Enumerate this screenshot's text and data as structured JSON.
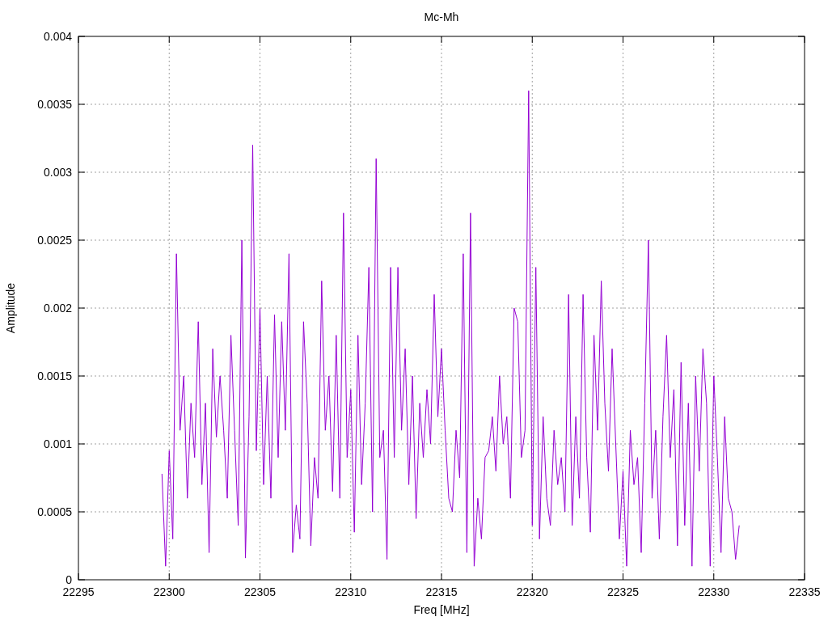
{
  "chart_data": {
    "type": "line",
    "title": "Mc-Mh",
    "xlabel": "Freq [MHz]",
    "ylabel": "Amplitude",
    "xlim": [
      22295,
      22335
    ],
    "ylim": [
      0,
      0.004
    ],
    "xticks": [
      22295,
      22300,
      22305,
      22310,
      22315,
      22320,
      22325,
      22330,
      22335
    ],
    "yticks": [
      0,
      0.0005,
      0.001,
      0.0015,
      0.002,
      0.0025,
      0.003,
      0.0035,
      0.004
    ],
    "x": [
      22299.6,
      22299.8,
      22300,
      22300.2,
      22300.4,
      22300.6,
      22300.8,
      22301,
      22301.2,
      22301.4,
      22301.6,
      22301.8,
      22302,
      22302.2,
      22302.4,
      22302.6,
      22302.8,
      22303,
      22303.2,
      22303.4,
      22303.6,
      22303.8,
      22304,
      22304.2,
      22304.4,
      22304.6,
      22304.8,
      22305,
      22305.2,
      22305.4,
      22305.6,
      22305.8,
      22306,
      22306.2,
      22306.4,
      22306.6,
      22306.8,
      22307,
      22307.2,
      22307.4,
      22307.6,
      22307.8,
      22308,
      22308.2,
      22308.4,
      22308.6,
      22308.8,
      22309,
      22309.2,
      22309.4,
      22309.6,
      22309.8,
      22310,
      22310.2,
      22310.4,
      22310.6,
      22310.8,
      22311,
      22311.2,
      22311.4,
      22311.6,
      22311.8,
      22312,
      22312.2,
      22312.4,
      22312.6,
      22312.8,
      22313,
      22313.2,
      22313.4,
      22313.6,
      22313.8,
      22314,
      22314.2,
      22314.4,
      22314.6,
      22314.8,
      22315,
      22315.2,
      22315.4,
      22315.6,
      22315.8,
      22316,
      22316.2,
      22316.4,
      22316.6,
      22316.8,
      22317,
      22317.2,
      22317.4,
      22317.6,
      22317.8,
      22318,
      22318.2,
      22318.4,
      22318.6,
      22318.8,
      22319,
      22319.2,
      22319.4,
      22319.6,
      22319.8,
      22320,
      22320.2,
      22320.4,
      22320.6,
      22320.8,
      22321,
      22321.2,
      22321.4,
      22321.6,
      22321.8,
      22322,
      22322.2,
      22322.4,
      22322.6,
      22322.8,
      22323,
      22323.2,
      22323.4,
      22323.6,
      22323.8,
      22324,
      22324.2,
      22324.4,
      22324.6,
      22324.8,
      22325,
      22325.2,
      22325.4,
      22325.6,
      22325.8,
      22326,
      22326.2,
      22326.4,
      22326.6,
      22326.8,
      22327,
      22327.2,
      22327.4,
      22327.6,
      22327.8,
      22328,
      22328.2,
      22328.4,
      22328.6,
      22328.8,
      22329,
      22329.2,
      22329.4,
      22329.6,
      22329.8,
      22330,
      22330.2,
      22330.4,
      22330.6,
      22330.8,
      22331,
      22331.2,
      22331.4
    ],
    "grid": true,
    "series": [
      {
        "color": "#9400d3",
        "values": [
          0.00078,
          0.0001,
          0.00095,
          0.0003,
          0.0024,
          0.0011,
          0.0015,
          0.0006,
          0.0013,
          0.0009,
          0.0019,
          0.0007,
          0.0013,
          0.0002,
          0.0017,
          0.00105,
          0.0015,
          0.0011,
          0.0006,
          0.0018,
          0.0011,
          0.0004,
          0.0025,
          0.00016,
          0.0012,
          0.0032,
          0.00095,
          0.002,
          0.0007,
          0.0015,
          0.0006,
          0.00195,
          0.0009,
          0.0019,
          0.0011,
          0.0024,
          0.0002,
          0.00055,
          0.0003,
          0.0019,
          0.0013,
          0.00025,
          0.0009,
          0.0006,
          0.0022,
          0.0011,
          0.0015,
          0.00065,
          0.0018,
          0.0006,
          0.0027,
          0.0009,
          0.0014,
          0.00035,
          0.0018,
          0.0007,
          0.0013,
          0.0023,
          0.0005,
          0.0031,
          0.0009,
          0.0011,
          0.00015,
          0.0023,
          0.0009,
          0.0023,
          0.0011,
          0.0017,
          0.0007,
          0.0015,
          0.00045,
          0.0013,
          0.0009,
          0.0014,
          0.001,
          0.0021,
          0.0012,
          0.0017,
          0.0011,
          0.0006,
          0.0005,
          0.0011,
          0.00075,
          0.0024,
          0.0002,
          0.0027,
          0.0001,
          0.0006,
          0.0003,
          0.0009,
          0.00095,
          0.0012,
          0.0008,
          0.0015,
          0.001,
          0.0012,
          0.0006,
          0.002,
          0.0019,
          0.0009,
          0.0011,
          0.0036,
          0.0004,
          0.0023,
          0.0003,
          0.0012,
          0.0006,
          0.0004,
          0.0011,
          0.0007,
          0.0009,
          0.0005,
          0.0021,
          0.0004,
          0.0012,
          0.0006,
          0.0021,
          0.0009,
          0.00035,
          0.0018,
          0.0011,
          0.0022,
          0.0013,
          0.0008,
          0.0017,
          0.001,
          0.0003,
          0.0008,
          0.0001,
          0.0011,
          0.0007,
          0.0009,
          0.0002,
          0.0013,
          0.0025,
          0.0006,
          0.0011,
          0.0003,
          0.0012,
          0.0018,
          0.0009,
          0.0014,
          0.00025,
          0.0016,
          0.0004,
          0.0013,
          0.0001,
          0.0015,
          0.0008,
          0.0017,
          0.0013,
          0.0001,
          0.0015,
          0.0009,
          0.0002,
          0.0012,
          0.0006,
          0.0005,
          0.00015,
          0.0004
        ]
      }
    ]
  }
}
